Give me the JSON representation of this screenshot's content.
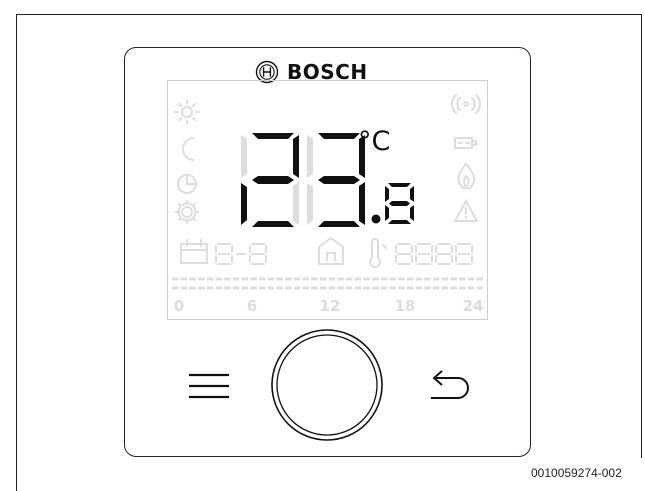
{
  "device": {
    "brand": "BOSCH",
    "display": {
      "temperature_digits": [
        "2",
        "3"
      ],
      "temperature_decimal": "8",
      "unit": "°C",
      "timeline_hours": [
        "0",
        "6",
        "12",
        "18",
        "24"
      ]
    },
    "controls": {
      "menu_icon": "menu-icon",
      "dial": "rotary-dial",
      "back_icon": "return-icon"
    }
  },
  "figure_code": "0010059274-002",
  "colors": {
    "active_segment": "#111111",
    "inactive_segment": "#dddddd",
    "outline": "#222222"
  }
}
